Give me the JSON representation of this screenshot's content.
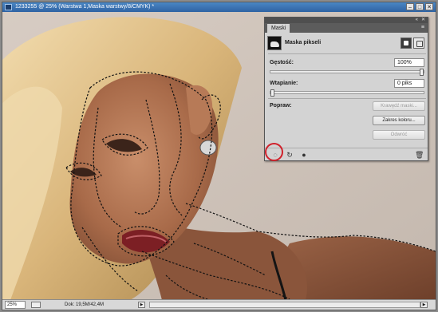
{
  "window": {
    "title": "1233255 @ 25% (Warstwa 1,Maska warstwy/8/CMYK) *",
    "controls": [
      "–",
      "□",
      "✕"
    ]
  },
  "status_bar": {
    "zoom": "25%",
    "doc_info": "Dok: 19,5M/42,4M"
  },
  "masks_panel": {
    "tab_label": "Maski",
    "mask_type": "Maska pikseli",
    "density": {
      "label": "Gęstość:",
      "value": "100%",
      "fraction": 1.0
    },
    "feather": {
      "label": "Wtapianie:",
      "value": "0 piks",
      "fraction": 0.0
    },
    "refine": {
      "label": "Popraw:",
      "buttons": {
        "mask_edge": "Krawędź maski...",
        "color_range": "Zakres koloru...",
        "invert": "Odwróć"
      }
    },
    "footer_icons": [
      "load-selection-icon",
      "apply-mask-icon",
      "disable-mask-icon",
      "delete-mask-icon"
    ]
  },
  "colors": {
    "title_bar": "#3a72b3",
    "highlight": "#d0202a",
    "panel_bg": "#d3d3d3"
  }
}
